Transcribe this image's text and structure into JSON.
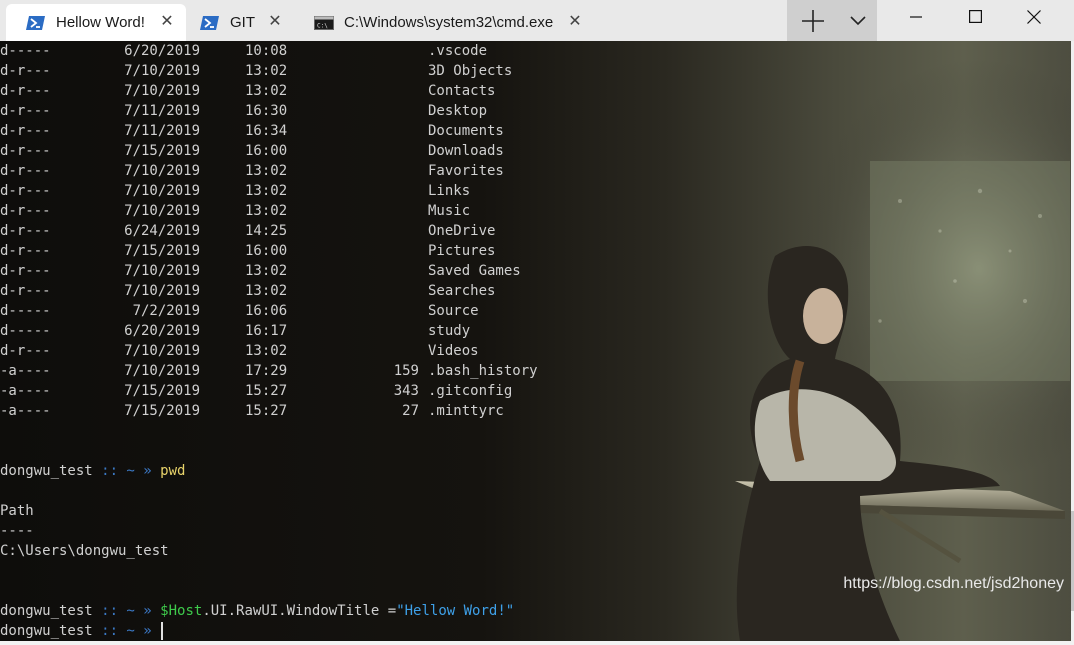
{
  "tabs": [
    {
      "title": "Hellow Word!",
      "icon": "powershell-icon",
      "active": true
    },
    {
      "title": "GIT",
      "icon": "powershell-icon",
      "active": false
    },
    {
      "title": "C:\\Windows\\system32\\cmd.exe",
      "icon": "cmd-icon",
      "active": false
    }
  ],
  "tab_close_glyph": "✕",
  "window_controls": {
    "new_tab": "+",
    "dropdown": "chevron-down-icon",
    "minimize": "minimize-icon",
    "maximize": "maximize-icon",
    "close": "close-icon"
  },
  "listing": [
    {
      "mode": "d-----",
      "date": "6/20/2019",
      "time": "10:08",
      "length": "",
      "name": ".vscode"
    },
    {
      "mode": "d-r---",
      "date": "7/10/2019",
      "time": "13:02",
      "length": "",
      "name": "3D Objects"
    },
    {
      "mode": "d-r---",
      "date": "7/10/2019",
      "time": "13:02",
      "length": "",
      "name": "Contacts"
    },
    {
      "mode": "d-r---",
      "date": "7/11/2019",
      "time": "16:30",
      "length": "",
      "name": "Desktop"
    },
    {
      "mode": "d-r---",
      "date": "7/11/2019",
      "time": "16:34",
      "length": "",
      "name": "Documents"
    },
    {
      "mode": "d-r---",
      "date": "7/15/2019",
      "time": "16:00",
      "length": "",
      "name": "Downloads"
    },
    {
      "mode": "d-r---",
      "date": "7/10/2019",
      "time": "13:02",
      "length": "",
      "name": "Favorites"
    },
    {
      "mode": "d-r---",
      "date": "7/10/2019",
      "time": "13:02",
      "length": "",
      "name": "Links"
    },
    {
      "mode": "d-r---",
      "date": "7/10/2019",
      "time": "13:02",
      "length": "",
      "name": "Music"
    },
    {
      "mode": "d-r---",
      "date": "6/24/2019",
      "time": "14:25",
      "length": "",
      "name": "OneDrive"
    },
    {
      "mode": "d-r---",
      "date": "7/15/2019",
      "time": "16:00",
      "length": "",
      "name": "Pictures"
    },
    {
      "mode": "d-r---",
      "date": "7/10/2019",
      "time": "13:02",
      "length": "",
      "name": "Saved Games"
    },
    {
      "mode": "d-r---",
      "date": "7/10/2019",
      "time": "13:02",
      "length": "",
      "name": "Searches"
    },
    {
      "mode": "d-----",
      "date": "7/2/2019",
      "time": "16:06",
      "length": "",
      "name": "Source"
    },
    {
      "mode": "d-----",
      "date": "6/20/2019",
      "time": "16:17",
      "length": "",
      "name": "study"
    },
    {
      "mode": "d-r---",
      "date": "7/10/2019",
      "time": "13:02",
      "length": "",
      "name": "Videos"
    },
    {
      "mode": "-a----",
      "date": "7/10/2019",
      "time": "17:29",
      "length": "159",
      "name": ".bash_history"
    },
    {
      "mode": "-a----",
      "date": "7/15/2019",
      "time": "15:27",
      "length": "343",
      "name": ".gitconfig"
    },
    {
      "mode": "-a----",
      "date": "7/15/2019",
      "time": "15:27",
      "length": "27",
      "name": ".minttyrc"
    }
  ],
  "prompt": {
    "user": "dongwu_test",
    "sep": " :: ~ » "
  },
  "pwd_block": {
    "command": "pwd",
    "header": "Path",
    "underline": "----",
    "value": "C:\\Users\\dongwu_test"
  },
  "title_command": {
    "var": "$Host",
    "rest": ".UI.RawUI.WindowTitle =",
    "string": "\"Hellow Word!\""
  },
  "watermark": "https://blog.csdn.net/jsd2honey",
  "colors": {
    "prompt_separator": "#3b78c4",
    "command": "#e8d36a",
    "variable": "#3ec94b",
    "string": "#3ea0e8"
  }
}
